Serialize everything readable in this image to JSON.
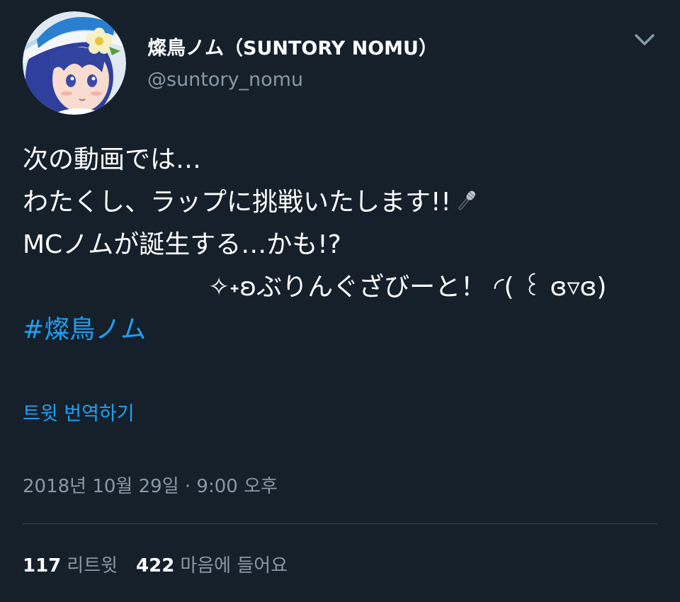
{
  "tweet": {
    "author": {
      "display_name": "燦鳥ノム（SUNTORY NOMU）",
      "handle": "@suntory_nomu",
      "avatar_icon": "avatar-anime-girl"
    },
    "text_lines": [
      "次の動画では…",
      "わたくし、ラップに挑戦いたします!!",
      "MCノムが誕生する…かも!?",
      "✧˖ʚぶりんぐざびーと！ ◜( ꒰ ɞ▿ɞ)"
    ],
    "mic_icon": "microphone-icon",
    "hashtag": "#燦鳥ノム",
    "translate_label": "트윗 번역하기",
    "timestamp": "2018년 10월 29일 · 9:00 오후",
    "stats": {
      "retweets_count": "117",
      "retweets_label": "리트윗",
      "likes_count": "422",
      "likes_label": "마음에 들어요"
    }
  },
  "colors": {
    "background": "#15202b",
    "link": "#1da1f2",
    "secondary_text": "#8899a6",
    "divider": "#38444d"
  }
}
